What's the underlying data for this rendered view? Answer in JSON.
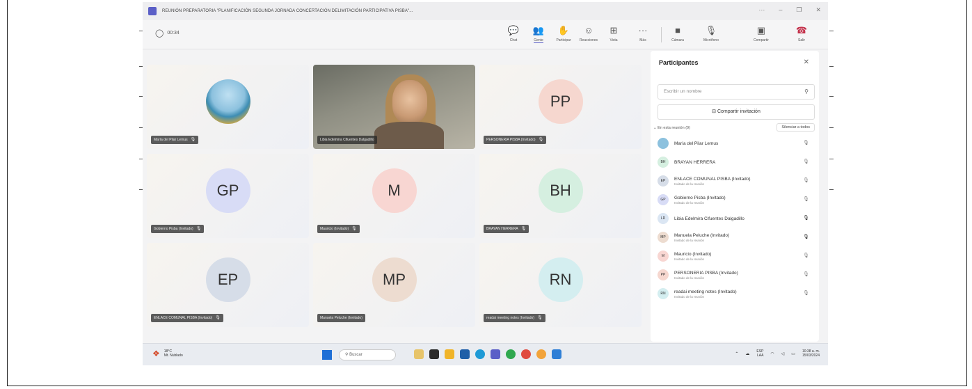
{
  "window": {
    "title": "REUNIÓN PREPARATORIA \"PLANIFICACIÓN SEGUNDA JORNADA CONCERTACIÓN DELIMITACIÓN PARTICIPATIVA PISBA\"..."
  },
  "toolbar": {
    "timer": "00:34",
    "buttons": [
      {
        "label": "Chat",
        "icon": "chat-icon"
      },
      {
        "label": "Gente",
        "icon": "people-icon"
      },
      {
        "label": "Participar",
        "icon": "raise-hand-icon"
      },
      {
        "label": "Reacciones",
        "icon": "reactions-icon"
      },
      {
        "label": "Vista",
        "icon": "view-icon"
      },
      {
        "label": "Más",
        "icon": "more-icon"
      },
      {
        "label": "Cámara",
        "icon": "camera-icon"
      },
      {
        "label": "Micrófono",
        "icon": "microphone-icon"
      },
      {
        "label": "Compartir",
        "icon": "share-icon"
      },
      {
        "label": "Salir",
        "icon": "leave-phone-icon"
      }
    ]
  },
  "tiles": [
    {
      "initials": "",
      "name": "María del Pilar Lemus",
      "color": "#bfe0f2"
    },
    {
      "initials": "",
      "name": "Libia Edelmira Cifuentes Dalgadillo",
      "color": "#8f8f83"
    },
    {
      "initials": "PP",
      "name": "PERSONERIA PISBA (Invitado)",
      "color": "#f6d7cf"
    },
    {
      "initials": "GP",
      "name": "Gobierno Pisba (Invitado)",
      "color": "#d8dcf6"
    },
    {
      "initials": "M",
      "name": "Mauricio (Invitado)",
      "color": "#f8d6d2"
    },
    {
      "initials": "BH",
      "name": "BRAYAN HERRERA",
      "color": "#d5efe0"
    },
    {
      "initials": "EP",
      "name": "ENLACE COMUNAL PISBA (Invitado)",
      "color": "#d6dde8"
    },
    {
      "initials": "MP",
      "name": "Manuela Peluche (Invitado)",
      "color": "#eddcd0"
    },
    {
      "initials": "RN",
      "name": "readai meeting notes (Invitado)",
      "color": "#d4eef0"
    }
  ],
  "panel": {
    "title": "Participantes",
    "search_placeholder": "Escribir un nombre",
    "share_label": "Compartir invitación",
    "section_label": "En esta reunión (9)",
    "mute_all_label": "Silenciar a todos",
    "participants": [
      {
        "initials": "",
        "name": "María del Pilar Lemus",
        "sub": "",
        "color": "#8cc1de"
      },
      {
        "initials": "BH",
        "name": "BRAYAN HERRERA",
        "sub": "",
        "color": "#d5efe0"
      },
      {
        "initials": "EP",
        "name": "ENLACE COMUNAL PISBA (Invitado)",
        "sub": "Invitado de la reunión",
        "color": "#d6dde8"
      },
      {
        "initials": "GP",
        "name": "Gobierno Pisba (Invitado)",
        "sub": "Invitado de la reunión",
        "color": "#d8dcf6"
      },
      {
        "initials": "LD",
        "name": "Libia Edelmira Cifuentes Dalgadillo",
        "sub": "",
        "color": "#dbe6f3"
      },
      {
        "initials": "MP",
        "name": "Manuela Peluche (Invitado)",
        "sub": "Invitado de la reunión",
        "color": "#eddcd0"
      },
      {
        "initials": "M",
        "name": "Mauricio (Invitado)",
        "sub": "Invitado de la reunión",
        "color": "#f8d6d2"
      },
      {
        "initials": "PP",
        "name": "PERSONERIA PISBA (Invitado)",
        "sub": "Invitado de la reunión",
        "color": "#f6d7cf"
      },
      {
        "initials": "RN",
        "name": "readai meeting notes (Invitado)",
        "sub": "Invitado de la reunión",
        "color": "#d4eef0"
      }
    ]
  },
  "taskbar": {
    "weather_temp": "18°C",
    "weather_desc": "Mt. Nublado",
    "search_placeholder": "Buscar",
    "lang": "ESP",
    "lang_sub": "LAA",
    "time": "10:38 a. m.",
    "date": "15/03/2024"
  }
}
